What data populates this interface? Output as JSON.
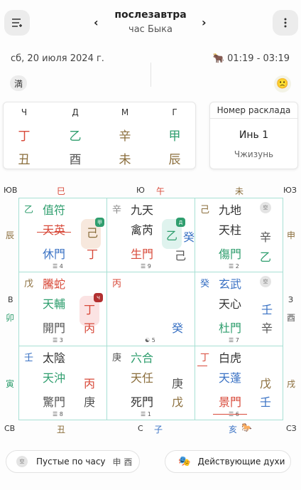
{
  "header": {
    "title": "послезавтра",
    "subtitle": "час Быка",
    "prev_arrow": "‹",
    "next_arrow": "›",
    "menu_icon": "sliders-menu-icon",
    "more_icon": "more-vertical-icon"
  },
  "info": {
    "date": "сб, 20 июля 2024 г.",
    "time_range": "01:19 - 03:19",
    "ox_emoji": "🐂",
    "full_chip": "満",
    "mood_emoji": "🙁"
  },
  "pillars": {
    "headers": [
      "Ч",
      "Д",
      "М",
      "Г"
    ],
    "stems": [
      "丁",
      "乙",
      "辛",
      "甲"
    ],
    "stem_colors": [
      "#d84a3a",
      "#2f9e6e",
      "#8a6d3b",
      "#2f9e6e"
    ],
    "branches": [
      "丑",
      "酉",
      "未",
      "辰"
    ],
    "branch_colors": [
      "#8a6d3b",
      "#555555",
      "#8a6d3b",
      "#8a6d3b"
    ]
  },
  "layout": {
    "title": "Номер расклада",
    "value": "Инь 1",
    "sub": "Чжизунь"
  },
  "edges": {
    "corner_se": "ЮВ",
    "corner_s": "Ю",
    "corner_sw": "ЮЗ",
    "corner_ne": "СВ",
    "corner_n": "С",
    "corner_nw": "СЗ",
    "east": "В",
    "west": "З",
    "top_branches": [
      "巳",
      "午",
      "未"
    ],
    "bottom_branches": [
      "丑",
      "子",
      "亥"
    ],
    "left_branches": [
      "辰",
      "卯",
      "寅"
    ],
    "right_branches": [
      "申",
      "酉",
      "戌"
    ]
  },
  "palaces": [
    {
      "earth_stem": "乙",
      "top_star": "值符",
      "door_god": "天英",
      "door": "休門",
      "heaven_stems": [
        "己",
        "丁"
      ],
      "trigram_num": "4",
      "badge": "甲"
    },
    {
      "earth_stem": "辛",
      "top_star": "九天",
      "door_god": "禽芮",
      "door": "生門",
      "heaven_stems": [
        "乙",
        "癸",
        "己"
      ],
      "trigram_num": "9",
      "badge": "Д"
    },
    {
      "earth_stem": "己",
      "top_star": "九地",
      "door_god": "天柱",
      "door": "傷門",
      "heaven_stems": [
        "辛",
        "乙"
      ],
      "trigram_num": "2",
      "void_label": "空"
    },
    {
      "earth_stem": "戊",
      "top_star": "騰蛇",
      "door_god": "天輔",
      "door": "開門",
      "heaven_stems": [
        "丁",
        "丙"
      ],
      "trigram_num": "3",
      "badge": "Ч"
    },
    {
      "earth_stem": "丙",
      "heaven_stems": [
        "癸"
      ],
      "trigram_num": "5"
    },
    {
      "earth_stem": "癸",
      "top_star": "玄武",
      "door_god": "天心",
      "door": "杜門",
      "heaven_stems": [
        "壬",
        "辛"
      ],
      "trigram_num": "7",
      "void_label": "空"
    },
    {
      "earth_stem": "壬",
      "top_star": "太陰",
      "door_god": "天沖",
      "door": "驚門",
      "heaven_stems": [
        "丙",
        "庚"
      ],
      "trigram_num": "8"
    },
    {
      "earth_stem": "庚",
      "top_star": "六合",
      "door_god": "天任",
      "door": "死門",
      "heaven_stems": [
        "庚",
        "戊"
      ],
      "trigram_num": "1"
    },
    {
      "earth_stem": "丁",
      "top_star": "白虎",
      "door_god": "天蓬",
      "door": "景門",
      "heaven_stems": [
        "戊",
        "壬"
      ],
      "trigram_num": "6"
    }
  ],
  "bottom": {
    "void_button": "Пустые по часу",
    "void_values": "申 酉",
    "void_icon_label": "空",
    "spirits_button": "Действующие духи",
    "spirits_icon": "🎭"
  },
  "colors": {
    "red": "#d84a3a",
    "green": "#2f9e6e",
    "blue": "#3a72c4",
    "brown": "#8a6d3b",
    "grid": "#a8e0d4"
  }
}
